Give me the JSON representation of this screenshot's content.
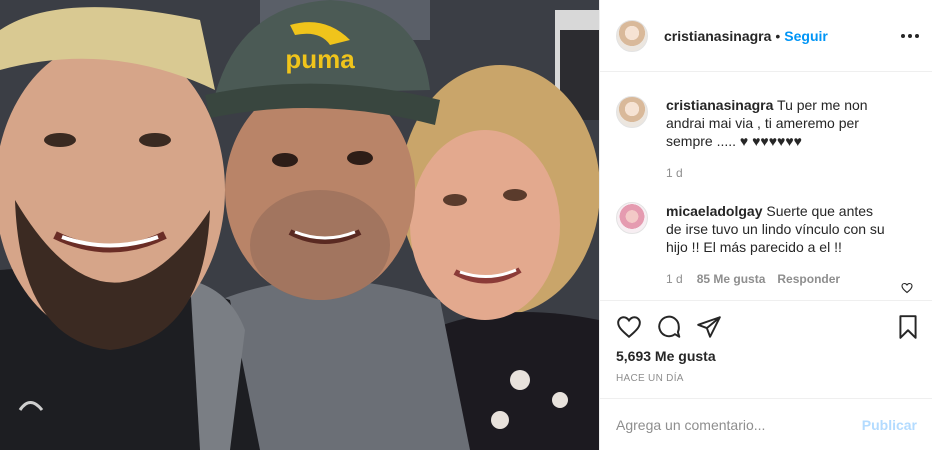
{
  "post": {
    "username": "cristianasinagra",
    "separator": "•",
    "follow_label": "Seguir",
    "photo_cap_text": "puma"
  },
  "comments": [
    {
      "username": "cristianasinagra",
      "text": "Tu per me non andrai mai via , ti ameremo per sempre ..... ♥ ♥♥♥♥♥♥",
      "time": "1 d"
    },
    {
      "username": "micaeladolgay",
      "text": "Suerte que antes de irse tuvo un lindo vínculo con su hijo !! El más parecido a el !!",
      "time": "1 d",
      "likes": "85 Me gusta",
      "reply_label": "Responder"
    }
  ],
  "actions": {
    "likes": "5,693 Me gusta",
    "time_ago": "HACE UN DÍA"
  },
  "add_comment": {
    "placeholder": "Agrega un comentario...",
    "publish_label": "Publicar"
  },
  "colors": {
    "link_blue": "#0095f6",
    "publish_disabled": "#b3dbff",
    "muted": "#8e8e8e",
    "text": "#262626"
  }
}
